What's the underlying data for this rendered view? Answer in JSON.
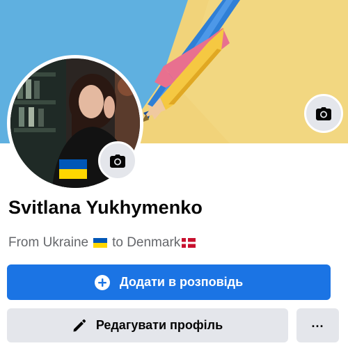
{
  "profile": {
    "name": "Svitlana Yukhymenko",
    "bio_prefix": "From Ukraine",
    "bio_connector": "to Denmark"
  },
  "actions": {
    "add_story_label": "Додати в розповідь",
    "edit_profile_label": "Редагувати профіль",
    "more_label": "..."
  },
  "icons": {
    "cover_camera": "camera-icon",
    "avatar_camera": "camera-icon",
    "add": "plus-circle-icon",
    "edit": "pencil-icon",
    "more": "more-dots-icon"
  },
  "colors": {
    "primary_button": "#1b74e4",
    "secondary_button": "#e4e6eb",
    "name_text": "#050505",
    "bio_text": "#65676b",
    "flag_blue": "#0057b7",
    "flag_yellow": "#ffd700",
    "denmark_red": "#c8102e"
  }
}
